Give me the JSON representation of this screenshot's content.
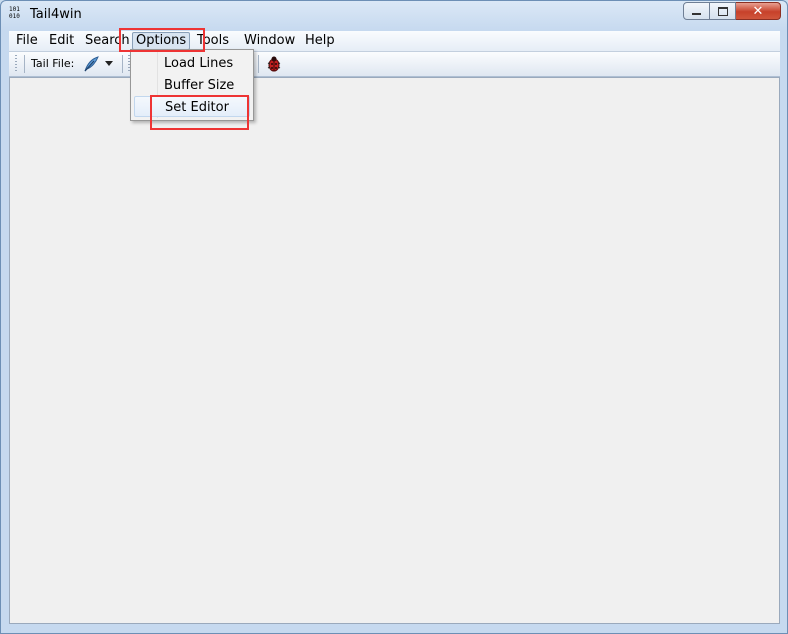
{
  "window": {
    "title": "Tail4win",
    "app_icon_text": "101\n010"
  },
  "window_controls": {
    "minimize": "–",
    "maximize": "□",
    "close": "✕"
  },
  "menu": {
    "items": [
      "File",
      "Edit",
      "Search",
      "Options",
      "Tools",
      "Window",
      "Help"
    ],
    "active": "Options"
  },
  "toolbar": {
    "tail_file_label": "Tail File:"
  },
  "options_menu": {
    "items": [
      "Load Lines",
      "Buffer Size",
      "Set Editor"
    ],
    "highlighted": "Set Editor"
  },
  "annotations": {
    "highlight_color": "#ee3434"
  },
  "icons": [
    "app-icon",
    "feather-icon",
    "dropdown-arrow-icon",
    "bug-icon"
  ]
}
